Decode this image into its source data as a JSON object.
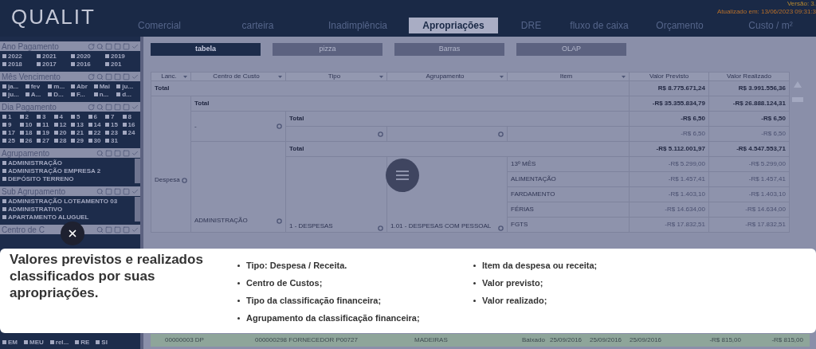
{
  "header": {
    "logo": "QUALIT",
    "version": "Versão: 3.",
    "updated": "Atualizado em: 13/06/2023 09:31:3",
    "tabs": [
      {
        "label": "Comercial",
        "selected": false
      },
      {
        "label": "carteira",
        "selected": false
      },
      {
        "label": "Inadimplência",
        "selected": false
      },
      {
        "label": "Apropriações",
        "selected": true
      },
      {
        "label": "DRE",
        "selected": false
      },
      {
        "label": "fluxo de caixa",
        "selected": false
      },
      {
        "label": "Orçamento",
        "selected": false
      },
      {
        "label": "Custo / m²",
        "selected": false
      }
    ]
  },
  "filters": [
    {
      "title": "Ano Pagamento",
      "kind": "grid",
      "has_reset": true,
      "rows": [
        [
          "2022",
          "2021",
          "2020",
          "2019"
        ],
        [
          "2018",
          "2017",
          "2016",
          "201"
        ]
      ]
    },
    {
      "title": "Mês Vencimento",
      "kind": "grid",
      "has_reset": true,
      "rows": [
        [
          "ja...",
          "fev",
          "m...",
          "Abr",
          "Mai",
          "ju..."
        ],
        [
          "ju...",
          "A...",
          "D...",
          "F...",
          "n...",
          "d..."
        ]
      ]
    },
    {
      "title": "Dia Pagamento",
      "kind": "grid",
      "has_reset": true,
      "rows": [
        [
          "1",
          "2",
          "3",
          "4",
          "5",
          "6",
          "7",
          "8"
        ],
        [
          "9",
          "10",
          "11",
          "12",
          "13",
          "14",
          "15",
          "16"
        ],
        [
          "17",
          "18",
          "19",
          "20",
          "21",
          "22",
          "23",
          "24"
        ],
        [
          "25",
          "26",
          "27",
          "28",
          "29",
          "30",
          "31"
        ]
      ]
    },
    {
      "title": "Agrupamento",
      "kind": "list",
      "has_reset": false,
      "items": [
        "ADMINISTRAÇÃO",
        "ADMINISTRAÇÃO EMPRESA 2",
        "DEPÓSITO TERRENO"
      ]
    },
    {
      "title": "Sub Agrupamento",
      "kind": "list",
      "has_reset": false,
      "items": [
        "ADMINISTRAÇÃO LOTEAMENTO 03",
        "ADMINISTRATIVO",
        "APARTAMENTO ALUGUEL"
      ]
    },
    {
      "title": "Centro de C",
      "kind": "header",
      "has_reset": false
    }
  ],
  "bottom_filter": [
    "EM",
    "MEU",
    "rel...",
    "RE",
    "SI"
  ],
  "views": [
    {
      "label": "tabela",
      "selected": true
    },
    {
      "label": "pizza",
      "selected": false
    },
    {
      "label": "Barras",
      "selected": false
    },
    {
      "label": "OLAP",
      "selected": false
    }
  ],
  "table": {
    "columns": [
      "Lanc.",
      "Centro de Custo",
      "Tipo",
      "Agrupamento",
      "Item",
      "Valor Previsto",
      "Valor Realizado"
    ],
    "grand_total": {
      "label": "Total",
      "previsto": "R$ 8.775.671,24",
      "realizado": "R$ 3.991.556,36"
    },
    "group": {
      "lanc": "Despesa",
      "total_label": "Total",
      "previsto": "-R$ 35.355.834,79",
      "realizado": "-R$ 26.888.124,31",
      "centros": [
        {
          "name": "-",
          "total_label": "Total",
          "previsto": "-R$ 6,50",
          "realizado": "-R$ 6,50",
          "line": {
            "previsto": "-R$ 6,50",
            "realizado": "-R$ 6,50"
          }
        },
        {
          "name": "ADMINISTRAÇÃO",
          "total_label": "Total",
          "previsto": "-R$ 5.112.001,97",
          "realizado": "-R$ 4.547.553,71",
          "tipo": "1 - DESPESAS",
          "agrupamento": "1.01 - DESPESAS COM PESSOAL",
          "items": [
            {
              "name": "13º MÊS",
              "previsto": "-R$ 5.299,00",
              "realizado": "-R$ 5.299,00"
            },
            {
              "name": "ALIMENTAÇÃO",
              "previsto": "-R$ 1.457,41",
              "realizado": "-R$ 1.457,41"
            },
            {
              "name": "FARDAMENTO",
              "previsto": "-R$ 1.403,10",
              "realizado": "-R$ 1.403,10"
            },
            {
              "name": "FÉRIAS",
              "previsto": "-R$ 14.634,00",
              "realizado": "-R$ 14.634,00"
            },
            {
              "name": "FGTS",
              "previsto": "-R$ 17.832,51",
              "realizado": "-R$ 17.832,51"
            }
          ]
        }
      ]
    }
  },
  "bottom_row": [
    "00000003 DP",
    "000000298 FORNECEDOR P00727",
    "MADEIRAS",
    "Baixado",
    "25/09/2016",
    "25/09/2016",
    "25/09/2016",
    "-R$ 815,00",
    "-R$ 815,00"
  ],
  "caption": {
    "title": "Valores previstos e realizados classificados por suas apropriações.",
    "bullets_left": [
      "Tipo: Despesa / Receita.",
      "Centro de Custos;",
      "Tipo da classificação financeira;",
      "Agrupamento da classificação financeira;"
    ],
    "bullets_right": [
      "Item da despesa ou receita;",
      "Valor previsto;",
      "Valor realizado;"
    ]
  }
}
